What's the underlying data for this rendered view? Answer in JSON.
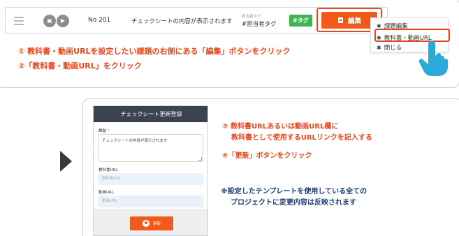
{
  "row": {
    "number": "No 201",
    "message": "チェックシートの内容が表示されます",
    "tag_label": "担当者タグ",
    "tag_value": "#担当者タグ",
    "tag_badge": "#タグ",
    "edit_button": "編集"
  },
  "menu": {
    "items": [
      {
        "label": "課題編集",
        "icon": "gear-icon"
      },
      {
        "label": "教科書・動画URL",
        "icon": "gear-icon"
      },
      {
        "label": "閉じる",
        "icon": "close-icon"
      }
    ]
  },
  "instructions": [
    "① 教科書・動画URLを設定したい課題の右側にある「編集」ボタンをクリック",
    "②「教科書・動画URL」をクリック"
  ],
  "form": {
    "title": "チェックシート更新登録",
    "issue_label": "課題",
    "required_mark": "*",
    "issue_value": "チェックシートの内容が表示されます",
    "textbook_label": "教科書URL",
    "textbook_placeholder": "教科書URL",
    "video_label": "動画URL",
    "video_placeholder": "動画URL",
    "update_button": "更新"
  },
  "steps": {
    "step3_line1": "③ 教科書URLあるいは動画URL欄に",
    "step3_line2": "教科書として使用するURLリンクを記入する",
    "step4": "④「更新」ボタンをクリック"
  },
  "note": {
    "line1": "※設定したテンプレートを使用している全ての",
    "line2": "プロジェクトに変更内容は反映されます"
  },
  "colors": {
    "accent": "#f25a1c",
    "highlight": "#e8471c",
    "tag": "#3eb454",
    "header": "#3d4251",
    "note_text": "#1b3f73",
    "hand": "#2ba9d9"
  }
}
